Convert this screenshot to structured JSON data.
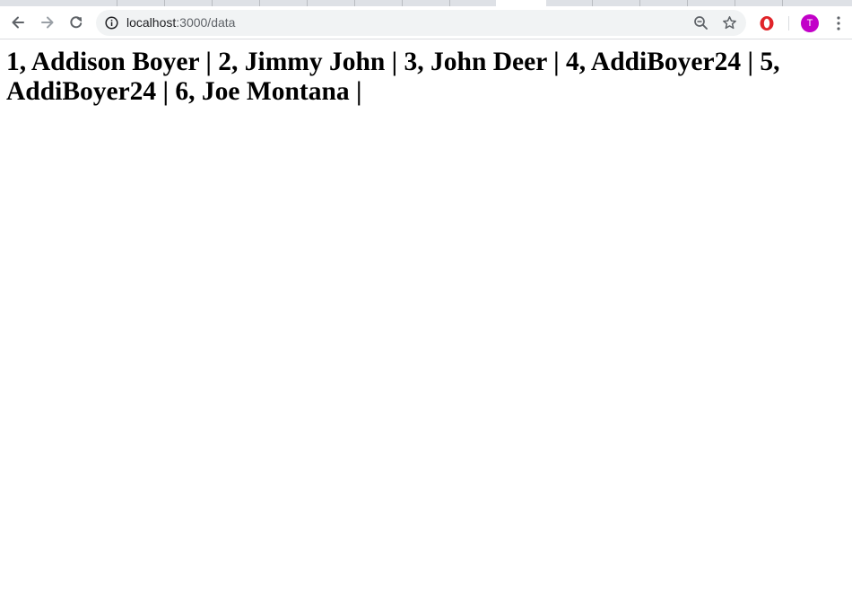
{
  "browser": {
    "url_host": "localhost",
    "url_path": ":3000/data",
    "avatar_letter": "T",
    "colors": {
      "avatar": "#c200c8",
      "opera_icon": "#e0242a",
      "omnibox_bg": "#f1f3f4",
      "tabstrip_bg": "#dee1e6"
    },
    "icons": {
      "back": "back-arrow-icon",
      "forward": "forward-arrow-icon",
      "reload": "reload-icon",
      "info": "info-icon",
      "zoom": "zoom-out-icon",
      "bookmark": "star-icon",
      "extension": "opera-icon",
      "menu": "kebab-menu-icon"
    }
  },
  "page": {
    "heading": "1, Addison Boyer | 2, Jimmy John | 3, John Deer | 4, AddiBoyer24 | 5, AddiBoyer24 | 6, Joe Montana |"
  }
}
